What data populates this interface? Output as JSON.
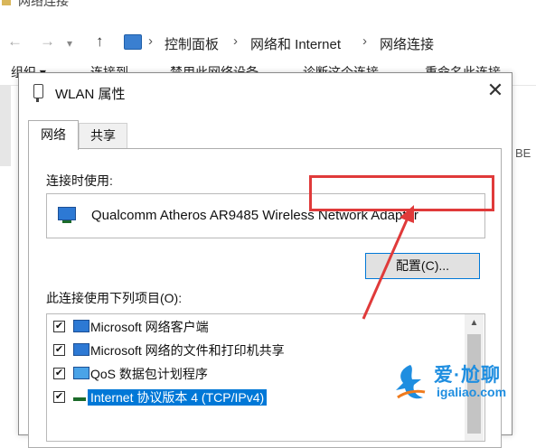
{
  "explorer": {
    "window_title": "网络连接",
    "nav": {
      "back": "←",
      "forward": "→",
      "up": "↑"
    },
    "breadcrumb": [
      "控制面板",
      "网络和 Internet",
      "网络连接"
    ],
    "breadcrumb_sep": "›",
    "toolbar": [
      "组织 ▾",
      "连接到",
      "禁用此网络设备",
      "诊断这个连接",
      "重命名此连接"
    ],
    "side_text": "BE"
  },
  "dialog": {
    "title": "WLAN 属性",
    "close_glyph": "✕",
    "tabs": [
      {
        "label": "网络",
        "active": true
      },
      {
        "label": "共享",
        "active": false
      }
    ],
    "connect_using_label": "连接时使用:",
    "adapter_name": "Qualcomm Atheros AR9485 Wireless Network Adapter",
    "configure_button": "配置(C)...",
    "items_label": "此连接使用下列项目(O):",
    "items": [
      {
        "label": "Microsoft 网络客户端",
        "checked": true,
        "icon": "network-client-icon",
        "selected": false
      },
      {
        "label": "Microsoft 网络的文件和打印机共享",
        "checked": true,
        "icon": "file-printer-sharing-icon",
        "selected": false
      },
      {
        "label": "QoS 数据包计划程序",
        "checked": true,
        "icon": "qos-icon",
        "selected": false
      },
      {
        "label": "Internet 协议版本 4 (TCP/IPv4)",
        "checked": true,
        "icon": "protocol-icon",
        "selected": true
      }
    ],
    "check_glyph": "✔",
    "scroll_up_glyph": "▲"
  },
  "annotation": {
    "highlight_color": "#e03a3a",
    "arrow_color": "#e03a3a"
  },
  "watermark": {
    "text": "爱·尬聊",
    "url": "igaliao.com",
    "color": "#1f8ee0"
  }
}
